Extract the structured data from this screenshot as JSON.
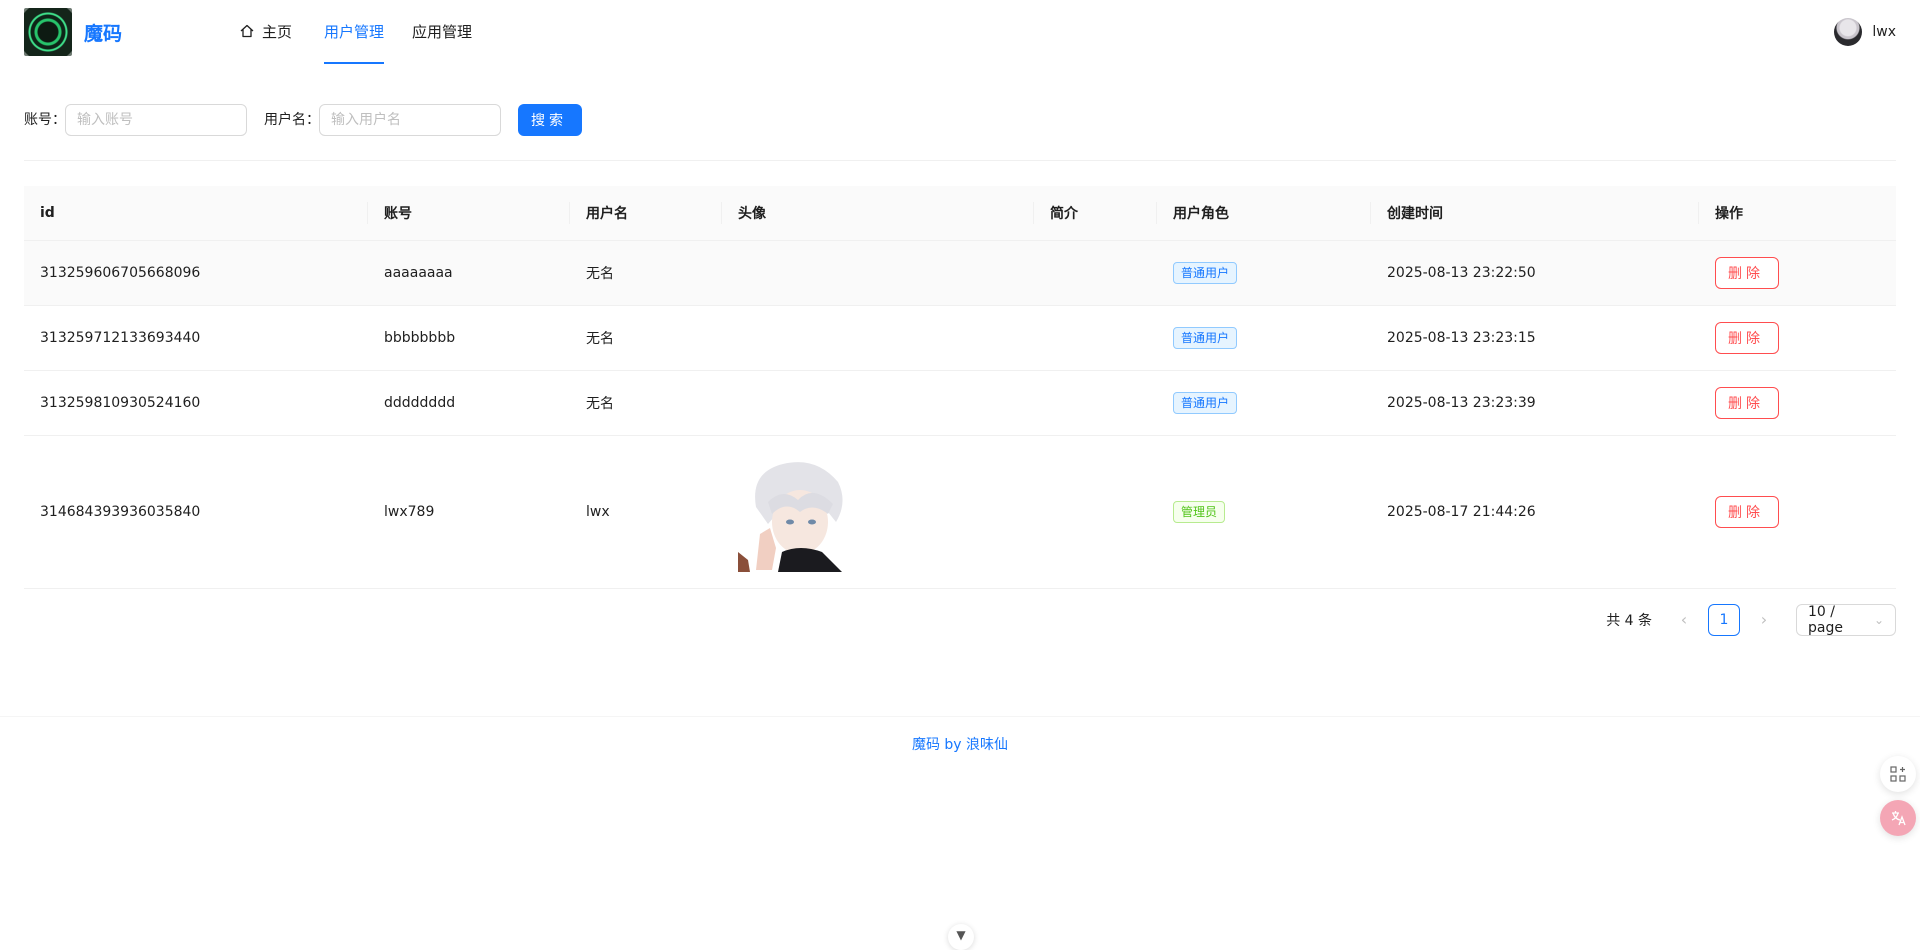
{
  "header": {
    "logo_text": "魔码",
    "nav": [
      {
        "label": "主页",
        "icon": "home-icon"
      },
      {
        "label": "用户管理",
        "active": true
      },
      {
        "label": "应用管理"
      }
    ],
    "user": {
      "name": "lwx"
    }
  },
  "search": {
    "account_label": "账号：",
    "account_placeholder": "输入账号",
    "username_label": "用户名：",
    "username_placeholder": "输入用户名",
    "button_label": "搜索"
  },
  "table": {
    "columns": [
      "id",
      "账号",
      "用户名",
      "头像",
      "简介",
      "用户角色",
      "创建时间",
      "操作"
    ],
    "rows": [
      {
        "id": "313259606705668096",
        "account": "aaaaaaaa",
        "name": "无名",
        "avatar": "",
        "intro": "",
        "role": "普通用户",
        "created": "2025-08-13 23:22:50",
        "action": "删除"
      },
      {
        "id": "313259712133693440",
        "account": "bbbbbbbb",
        "name": "无名",
        "avatar": "",
        "intro": "",
        "role": "普通用户",
        "created": "2025-08-13 23:23:15",
        "action": "删除"
      },
      {
        "id": "313259810930524160",
        "account": "dddddddd",
        "name": "无名",
        "avatar": "",
        "intro": "",
        "role": "普通用户",
        "created": "2025-08-13 23:23:39",
        "action": "删除"
      },
      {
        "id": "314684393936035840",
        "account": "lwx789",
        "name": "lwx",
        "avatar": "anime-avatar",
        "intro": "",
        "role": "管理员",
        "created": "2025-08-17 21:44:26",
        "action": "删除"
      }
    ]
  },
  "pagination": {
    "total_text": "共 4 条",
    "current_page": "1",
    "page_size": "10 / page"
  },
  "footer": {
    "text": "魔码 by 浪味仙"
  },
  "colors": {
    "primary": "#1677ff",
    "danger": "#ff4d4f",
    "success": "#52c41a"
  }
}
